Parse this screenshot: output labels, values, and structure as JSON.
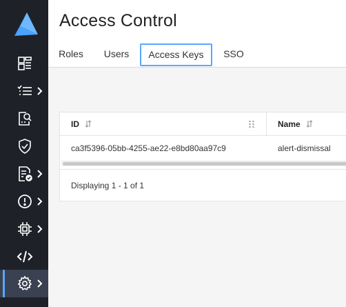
{
  "page": {
    "title": "Access Control"
  },
  "tabs": [
    {
      "label": "Roles"
    },
    {
      "label": "Users"
    },
    {
      "label": "Access Keys",
      "active": true
    },
    {
      "label": "SSO"
    }
  ],
  "table": {
    "columns": [
      {
        "label": "ID"
      },
      {
        "label": "Name"
      }
    ],
    "rows": [
      {
        "id": "ca3f5396-05bb-4255-ae22-e8bd80aa97c9",
        "name": "alert-dismissal"
      }
    ],
    "footer": "Displaying 1 - 1 of 1"
  },
  "sidebar": {
    "items": [
      {
        "icon": "dashboard-icon"
      },
      {
        "icon": "task-list-icon",
        "has_submenu": true
      },
      {
        "icon": "search-report-icon"
      },
      {
        "icon": "shield-check-icon"
      },
      {
        "icon": "document-check-icon",
        "has_submenu": true
      },
      {
        "icon": "alert-circle-icon",
        "has_submenu": true
      },
      {
        "icon": "chip-icon",
        "has_submenu": true
      },
      {
        "icon": "code-icon"
      },
      {
        "icon": "gear-icon",
        "has_submenu": true,
        "active": true
      }
    ]
  },
  "colors": {
    "accent": "#5aa7ff",
    "sidebar_bg": "#1e2128",
    "logo": "#4aa3ff"
  }
}
